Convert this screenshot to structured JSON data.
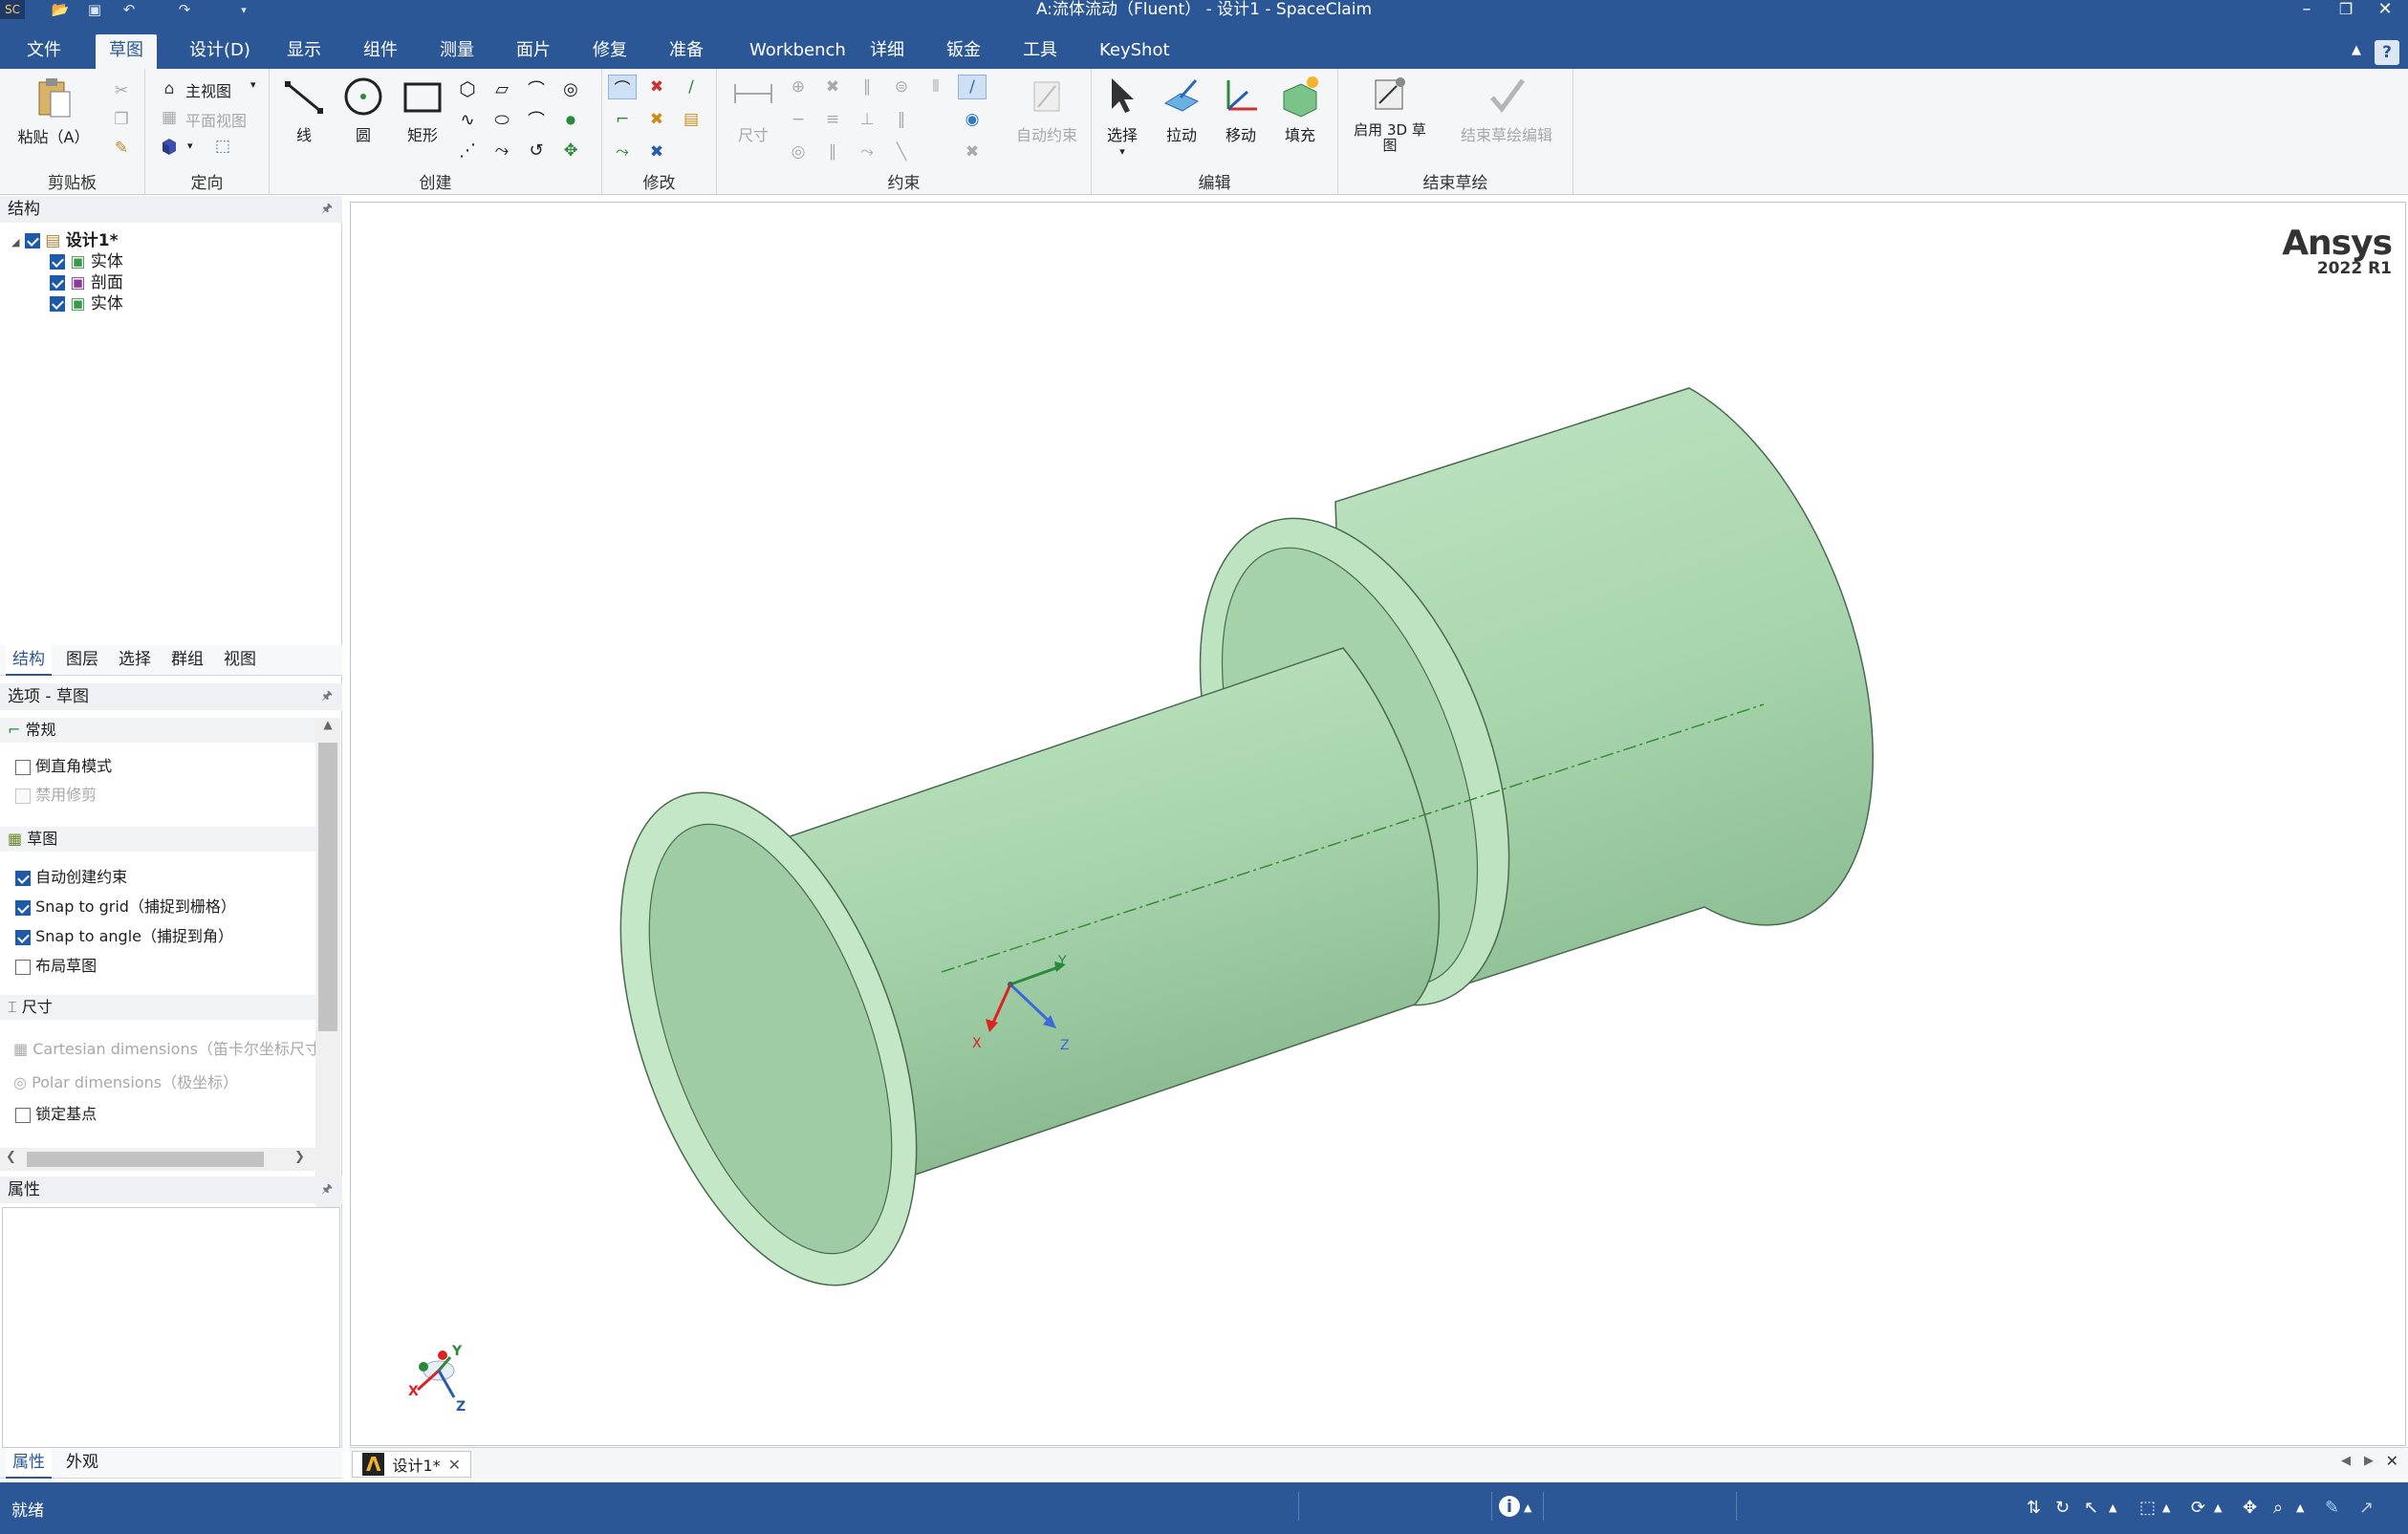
{
  "title": "A:流体流动（Fluent） - 设计1 - SpaceClaim",
  "menu": [
    "文件",
    "草图",
    "设计(D)",
    "显示",
    "组件",
    "测量",
    "面片",
    "修复",
    "准备",
    "Workbench",
    "详细",
    "钣金",
    "工具",
    "KeyShot"
  ],
  "menu_active": "草图",
  "ribbon": {
    "clipboard": {
      "label": "剪贴板",
      "paste": "粘贴（A）"
    },
    "orient": {
      "label": "定向",
      "home_view": "主视图",
      "plan_view": "平面视图"
    },
    "create": {
      "label": "创建",
      "line": "线",
      "circle": "圆",
      "rectangle": "矩形"
    },
    "modify": {
      "label": "修改"
    },
    "constraints": {
      "label": "约束",
      "dimension": "尺寸",
      "auto_constrain": "自动约束"
    },
    "edit": {
      "label": "编辑",
      "select": "选择",
      "pull": "拉动",
      "move": "移动",
      "fill": "填充"
    },
    "end_sketch": {
      "label": "结束草绘",
      "enable_3d": "启用 3D 草图",
      "end_edit": "结束草绘编辑"
    }
  },
  "structure": {
    "header": "结构",
    "root": "设计1*",
    "items": [
      {
        "label": "实体",
        "icon": "solid-body-icon"
      },
      {
        "label": "剖面",
        "icon": "section-icon"
      },
      {
        "label": "实体",
        "icon": "solid-body-icon"
      }
    ],
    "tabs": [
      "结构",
      "图层",
      "选择",
      "群组",
      "视图"
    ]
  },
  "options": {
    "header": "选项 - 草图",
    "general_section": "常规",
    "fillet_mode": "倒直角模式",
    "disable_trim": "禁用修剪",
    "sketch_section": "草图",
    "auto_create_constraints": "自动创建约束",
    "snap_to_grid": "Snap to grid（捕捉到栅格）",
    "snap_to_angle": "Snap to angle（捕捉到角）",
    "layout_sketch": "布局草图",
    "dimension_section": "尺寸",
    "cartesian": "Cartesian dimensions（笛卡尔坐标尺寸）",
    "polar": "Polar dimensions（极坐标）",
    "lock_base": "锁定基点"
  },
  "properties": {
    "header": "属性",
    "tabs": [
      "属性",
      "外观"
    ]
  },
  "viewport": {
    "brand": "Ansys",
    "version": "2022 R1",
    "axis_x": "X",
    "axis_y": "Y",
    "axis_z": "Z",
    "model_color": "#b7e0bb"
  },
  "doc_tab": "设计1*",
  "status": {
    "text": "就绪"
  }
}
